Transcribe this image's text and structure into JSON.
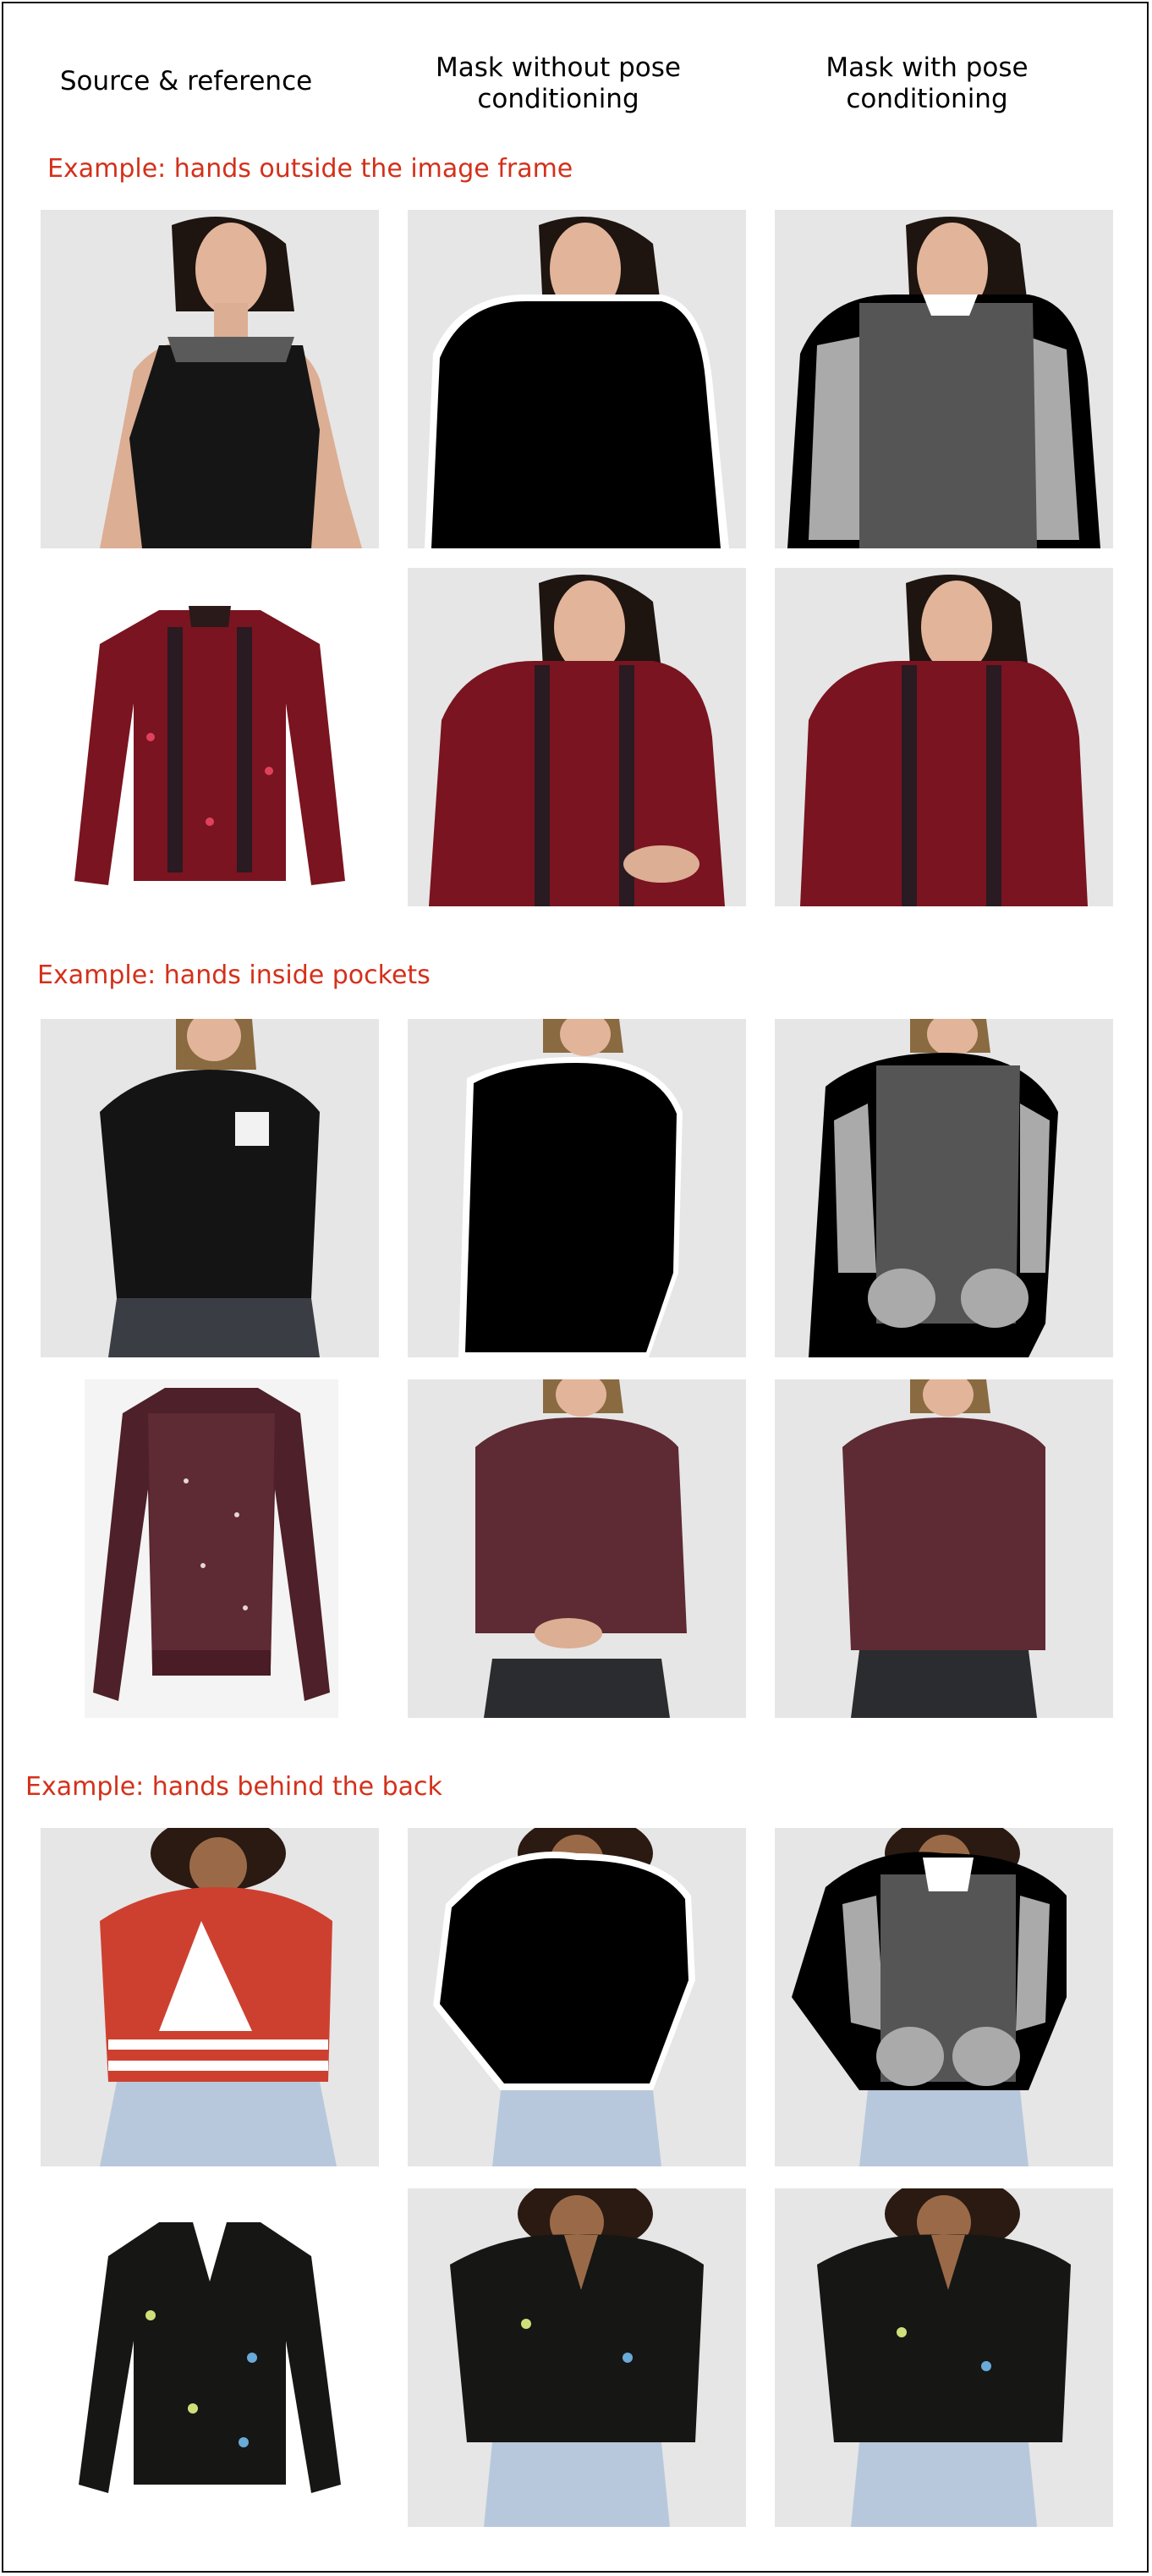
{
  "headers": {
    "col1": "Source & reference",
    "col2": "Mask without pose\nconditioning",
    "col3": "Mask with pose\nconditioning"
  },
  "sections": [
    {
      "title": "Example: hands outside the image frame"
    },
    {
      "title": "Example: hands inside pockets"
    },
    {
      "title": "Example: hands behind the back"
    }
  ],
  "colors": {
    "title_red": "#d4301a",
    "mask_black": "#000000",
    "mask_torso": "#555555",
    "mask_arm": "#aaaaaa",
    "studio_bg": "#e6e6e6"
  },
  "garments": {
    "ex1_source": "#151515",
    "ex1_reference": "#7a1420",
    "ex2_source": "#141414",
    "ex2_reference": "#4e2029",
    "ex3_source": "#cd4030",
    "ex3_reference": "#161614"
  }
}
